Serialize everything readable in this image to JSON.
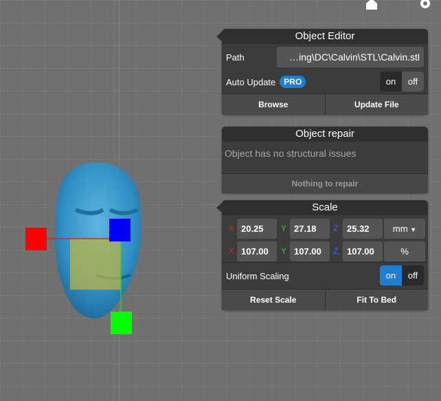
{
  "toolbar": {
    "home_icon": "home-icon",
    "settings_icon": "gear-icon"
  },
  "object_editor": {
    "title": "Object Editor",
    "path_label": "Path",
    "path_value": "…ing\\DC\\Calvin\\STL\\Calvin.stl",
    "auto_update_label": "Auto Update",
    "pro_badge": "PRO",
    "toggle_on": "on",
    "toggle_off": "off",
    "browse_label": "Browse",
    "update_file_label": "Update File"
  },
  "object_repair": {
    "title": "Object repair",
    "status": "Object has no structural issues",
    "repair_label": "Nothing to repair"
  },
  "scale": {
    "title": "Scale",
    "axis_x": "X",
    "axis_y": "Y",
    "axis_z": "Z",
    "size_x": "20.25",
    "size_y": "27.18",
    "size_z": "25.32",
    "unit": "mm",
    "pct_x": "107.00",
    "pct_y": "107.00",
    "pct_z": "107.00",
    "pct_unit": "%",
    "uniform_label": "Uniform Scaling",
    "uniform_on": "on",
    "uniform_off": "off",
    "reset_label": "Reset Scale",
    "fit_label": "Fit To Bed"
  },
  "colors": {
    "axis_x": "#e02020",
    "axis_y": "#2bd12b",
    "axis_z": "#1a1aff",
    "active_toggle": "#1e7fd0",
    "model": "#3a9bd0"
  }
}
